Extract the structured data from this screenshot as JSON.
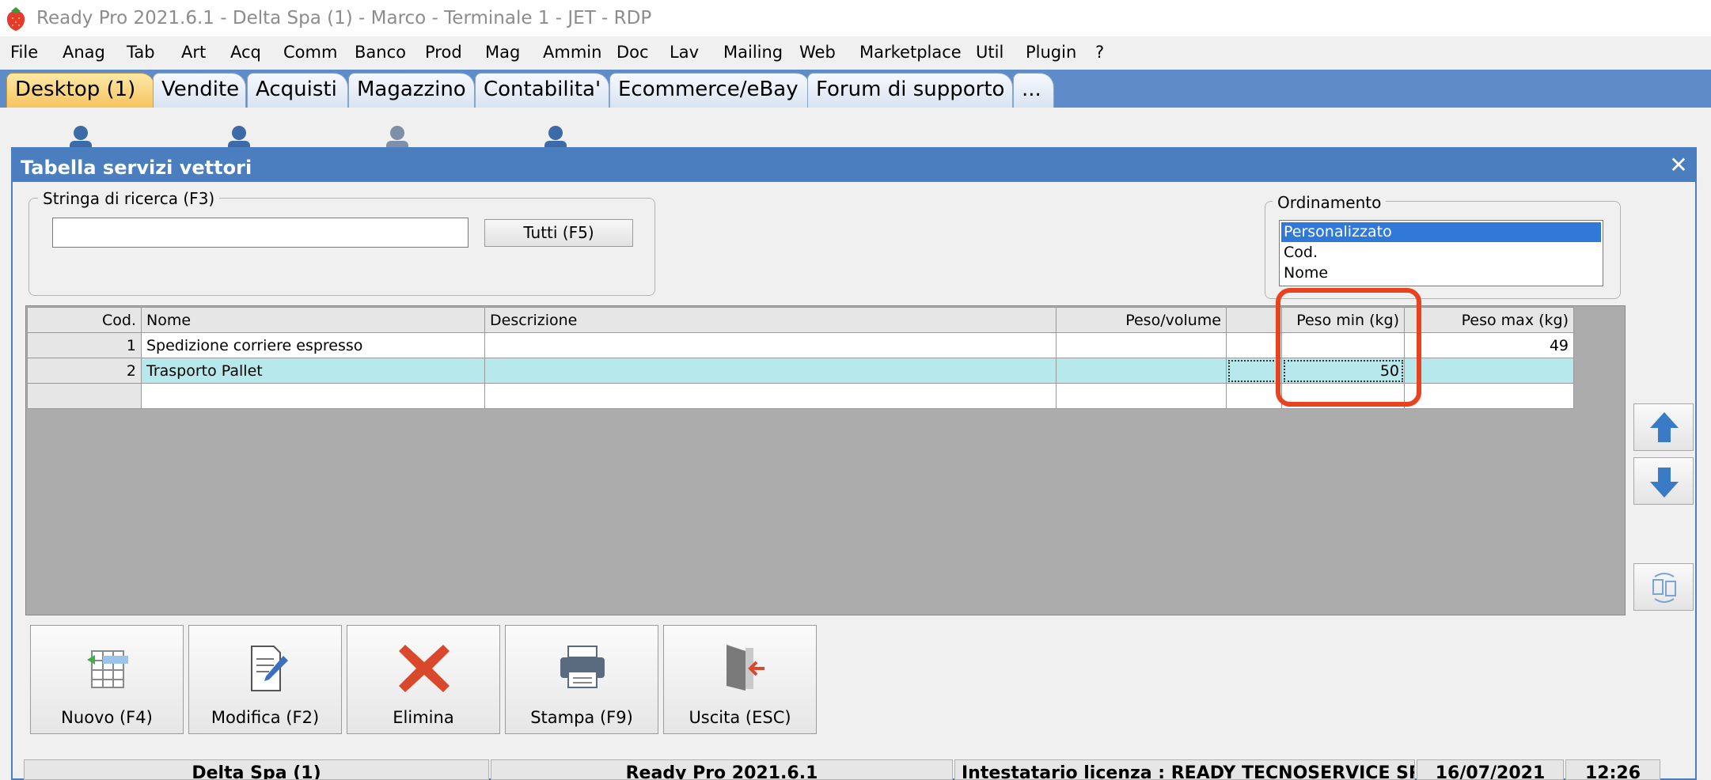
{
  "window": {
    "title": "Ready Pro 2021.6.1 - Delta Spa (1) - Marco - Terminale 1 - JET - RDP",
    "app_icon": "strawberry-icon"
  },
  "menu": {
    "items": [
      "File",
      "Anag",
      "Tab",
      "Art",
      "Acq",
      "Comm",
      "Banco",
      "Prod",
      "Mag",
      "Ammin",
      "Doc",
      "Lav",
      "Mailing",
      "Web",
      "Marketplace",
      "Util",
      "Plugin",
      "?"
    ]
  },
  "tabs": {
    "items": [
      "Desktop (1)",
      "Vendite",
      "Acquisti",
      "Magazzino",
      "Contabilita'",
      "Ecommerce/eBay",
      "Forum di supporto",
      "..."
    ],
    "active": "Desktop (1)"
  },
  "dialog": {
    "title": "Tabella servizi vettori",
    "close_icon": "close-icon",
    "search": {
      "legend": "Stringa di ricerca (F3)",
      "value": "",
      "button_label": "Tutti (F5)"
    },
    "ordering": {
      "legend": "Ordinamento",
      "options": [
        "Personalizzato",
        "Cod.",
        "Nome"
      ],
      "selected": "Personalizzato"
    },
    "grid": {
      "columns": [
        "Cod.",
        "Nome",
        "Descrizione",
        "Peso/volume",
        "",
        "Peso min (kg)",
        "Peso max (kg)"
      ],
      "rows": [
        {
          "cod": "1",
          "nome": "Spedizione corriere espresso",
          "descrizione": "",
          "peso_volume": "",
          "extra": "",
          "peso_min": "",
          "peso_max": "49"
        },
        {
          "cod": "2",
          "nome": "Trasporto Pallet",
          "descrizione": "",
          "peso_volume": "",
          "extra": "",
          "peso_min": "50",
          "peso_max": ""
        }
      ]
    },
    "side_buttons": [
      "arrow-up-icon",
      "arrow-down-icon",
      "swap-icon"
    ],
    "actions": {
      "new_label": "Nuovo (F4)",
      "edit_label": "Modifica (F2)",
      "delete_label": "Elimina",
      "print_label": "Stampa (F9)",
      "exit_label": "Uscita (ESC)"
    }
  },
  "statusbar": {
    "company": "Delta Spa (1)",
    "version": "Ready Pro 2021.6.1",
    "license": "Intestatario licenza : READY TECNOSERVICE SRL",
    "date": "16/07/2021",
    "time": "12:26"
  },
  "colors": {
    "accent": "#4a7ebf",
    "tab_strip": "#5d8cc9",
    "selected_row": "#b6e8ec",
    "highlight": "#e8421f"
  }
}
